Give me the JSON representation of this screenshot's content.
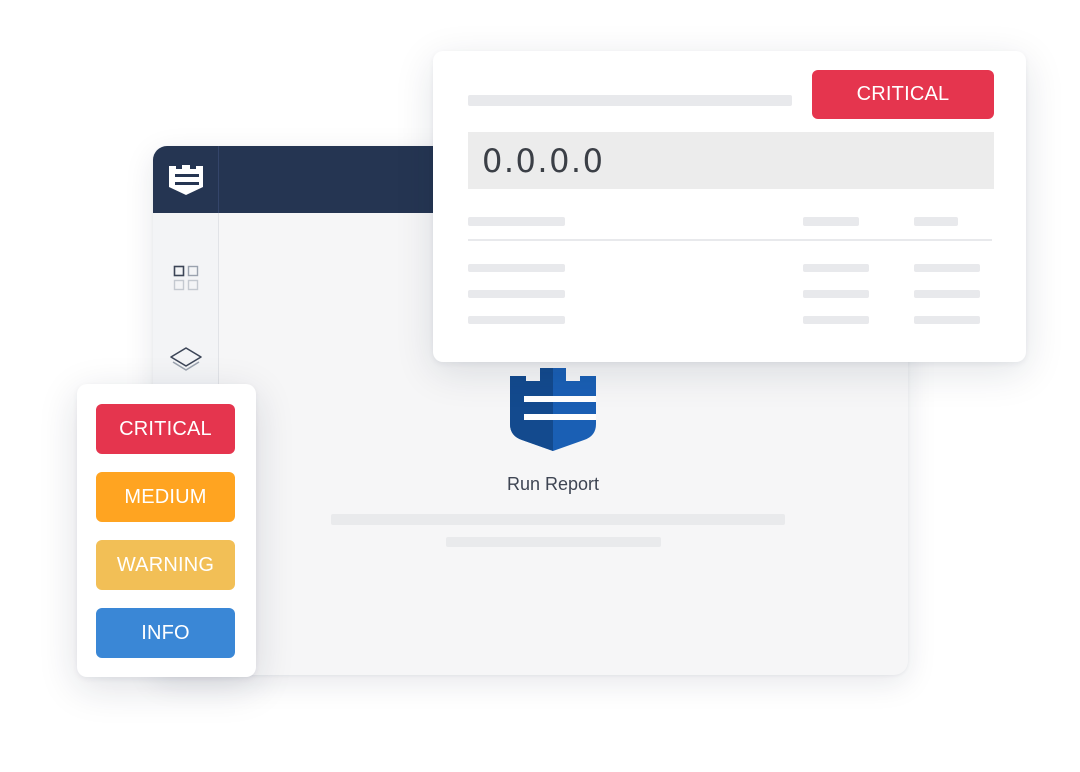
{
  "detail_card": {
    "severity_badge": "CRITICAL",
    "ip_address": "0.0.0.0"
  },
  "run_report": {
    "label": "Run Report"
  },
  "severity_legend": {
    "items": [
      {
        "label": "CRITICAL",
        "color": "#e5354e"
      },
      {
        "label": "MEDIUM",
        "color": "#ffa421"
      },
      {
        "label": "WARNING",
        "color": "#f2bf56"
      },
      {
        "label": "INFO",
        "color": "#3a87d6"
      }
    ]
  },
  "colors": {
    "topbar": "#253552",
    "critical": "#e5354e",
    "brand_blue": "#1a5fb4"
  },
  "icons": {
    "brand_logo": "shield-tower-icon",
    "dashboard": "grid-icon",
    "layers": "layers-icon"
  }
}
